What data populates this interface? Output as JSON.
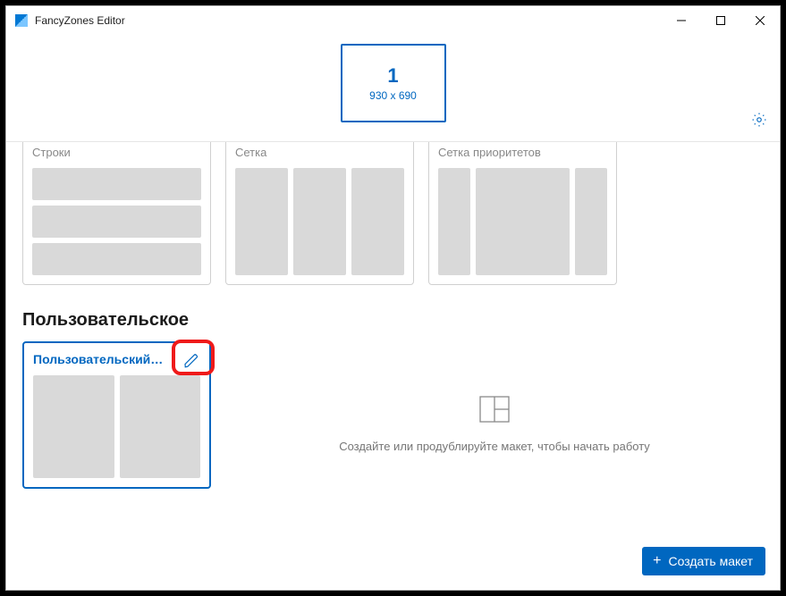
{
  "window": {
    "title": "FancyZones Editor"
  },
  "monitor": {
    "number": "1",
    "resolution": "930 x 690"
  },
  "templates": [
    {
      "name": "Строки"
    },
    {
      "name": "Сетка"
    },
    {
      "name": "Сетка приоритетов"
    }
  ],
  "section_custom": "Пользовательское",
  "custom_layout": {
    "name": "Пользовательский…"
  },
  "placeholder": {
    "text": "Создайте или продублируйте макет, чтобы начать работу"
  },
  "create_button": {
    "label": "Создать макет"
  }
}
